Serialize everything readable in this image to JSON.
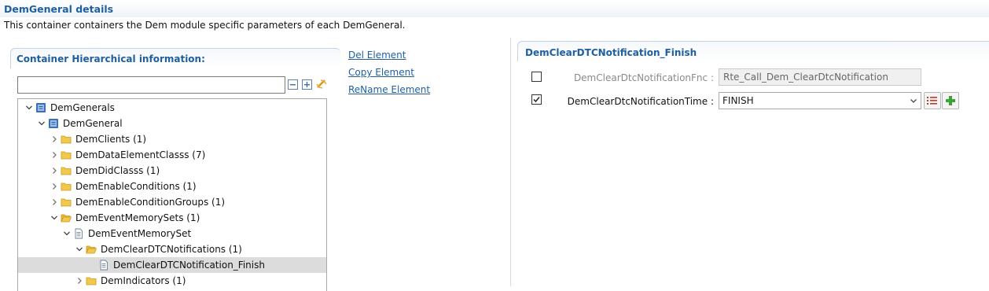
{
  "header": {
    "title": "DemGeneral details",
    "description": "This container containers the Dem module specific parameters of each DemGeneral."
  },
  "left_panel": {
    "title": "Container Hierarchical information:",
    "filter": {
      "value": "",
      "placeholder": ""
    },
    "tools": [
      "collapse-all-icon",
      "expand-all-icon",
      "sync-link-icon"
    ],
    "tree": [
      {
        "label": "DemGenerals",
        "depth": 0,
        "expanded": true,
        "icon": "module-icon"
      },
      {
        "label": "DemGeneral",
        "depth": 1,
        "expanded": true,
        "icon": "module-icon"
      },
      {
        "label": "DemClients (1)",
        "depth": 2,
        "expanded": false,
        "icon": "folder-icon"
      },
      {
        "label": "DemDataElementClasss (7)",
        "depth": 2,
        "expanded": false,
        "icon": "folder-icon"
      },
      {
        "label": "DemDidClasss (1)",
        "depth": 2,
        "expanded": false,
        "icon": "folder-icon"
      },
      {
        "label": "DemEnableConditions (1)",
        "depth": 2,
        "expanded": false,
        "icon": "folder-icon"
      },
      {
        "label": "DemEnableConditionGroups (1)",
        "depth": 2,
        "expanded": false,
        "icon": "folder-icon"
      },
      {
        "label": "DemEventMemorySets (1)",
        "depth": 2,
        "expanded": true,
        "icon": "folder-open-icon"
      },
      {
        "label": "DemEventMemorySet",
        "depth": 3,
        "expanded": true,
        "icon": "document-icon"
      },
      {
        "label": "DemClearDTCNotifications (1)",
        "depth": 4,
        "expanded": true,
        "icon": "folder-open-icon"
      },
      {
        "label": "DemClearDTCNotification_Finish",
        "depth": 5,
        "expanded": null,
        "icon": "document-icon",
        "selected": true
      },
      {
        "label": "DemIndicators (1)",
        "depth": 4,
        "expanded": false,
        "icon": "folder-icon"
      }
    ]
  },
  "actions": {
    "delete": "Del Element",
    "copy": "Copy Element",
    "rename": "ReName Element"
  },
  "right_panel": {
    "title": "DemClearDTCNotification_Finish",
    "params": [
      {
        "name": "DemClearDtcNotificationFnc :",
        "checked": false,
        "enabled": false,
        "value": "Rte_Call_Dem_ClearDtcNotification",
        "kind": "text"
      },
      {
        "name": "DemClearDtcNotificationTime :",
        "checked": true,
        "enabled": true,
        "value": "FINISH",
        "kind": "select"
      }
    ],
    "buttons": [
      "list-icon",
      "add-icon"
    ]
  },
  "colors": {
    "accent": "#1f5f9f",
    "selection": "#dcdcdc",
    "folder": "#f2c94c",
    "module": "#3d6fb6"
  }
}
